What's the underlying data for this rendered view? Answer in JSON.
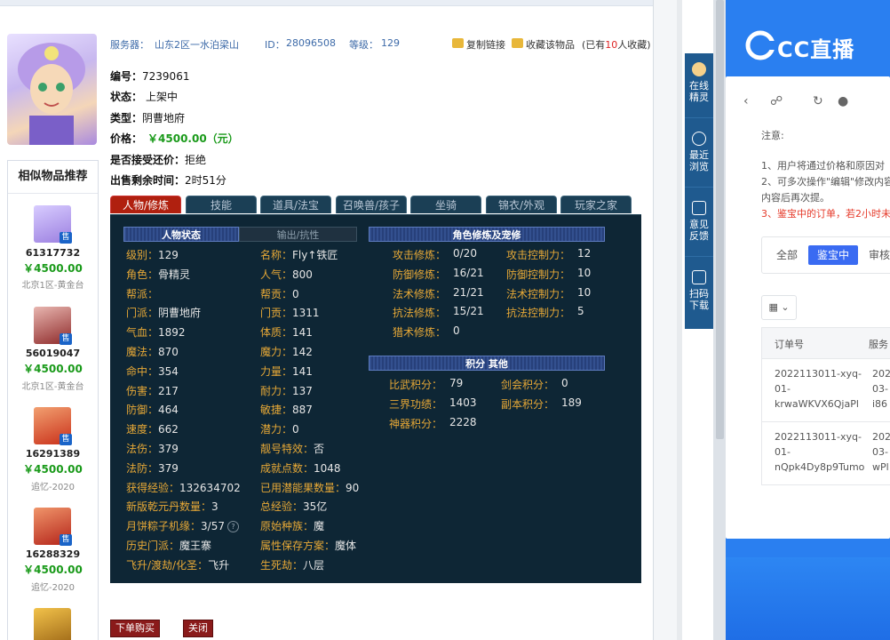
{
  "header": {
    "server_label": "服务器：",
    "server_value": "山东2区一水泊梁山",
    "id_label": "ID：",
    "id_value": "28096508",
    "level_label": "等级：",
    "level_value": "129",
    "copy_link": "复制链接",
    "favorite": "收藏该物品",
    "favorite_count_prefix": "(已有",
    "favorite_count": "10",
    "favorite_count_suffix": "人收藏)"
  },
  "info": {
    "number_label": "编号：",
    "number_value": "7239061",
    "status_label": "状态：",
    "status_value": "上架中",
    "type_label": "类型：",
    "type_value": "阴曹地府",
    "price_label": "价格：",
    "price_value": "￥4500.00（元）",
    "bargain_label": "是否接受还价：",
    "bargain_value": "拒绝",
    "remaining_label": "出售剩余时间：",
    "remaining_value": "2时51分"
  },
  "sidebar": {
    "title": "相似物品推荐",
    "badge": "售",
    "items": [
      {
        "id": "61317732",
        "price": "￥4500.00",
        "server": "北京1区-黄金台"
      },
      {
        "id": "56019047",
        "price": "￥4500.00",
        "server": "北京1区-黄金台"
      },
      {
        "id": "16291389",
        "price": "￥4500.00",
        "server": "追忆-2020"
      },
      {
        "id": "16288329",
        "price": "￥4500.00",
        "server": "追忆-2020"
      }
    ]
  },
  "tabs": [
    "人物/修炼",
    "技能",
    "道具/法宝",
    "召唤兽/孩子",
    "坐骑",
    "锦衣/外观",
    "玩家之家"
  ],
  "panel": {
    "subtab_active": "人物状态",
    "subtab_other": "输出/抗性",
    "cultivation_header": "角色修炼及宠修",
    "score_header": "积分 其他",
    "left_col": [
      {
        "label": "级别：",
        "value": "129"
      },
      {
        "label": "角色：",
        "value": "骨精灵"
      },
      {
        "label": "帮派：",
        "value": ""
      },
      {
        "label": "门派：",
        "value": "阴曹地府"
      },
      {
        "label": "气血：",
        "value": "1892"
      },
      {
        "label": "魔法：",
        "value": "870"
      },
      {
        "label": "命中：",
        "value": "354"
      },
      {
        "label": "伤害：",
        "value": "217"
      },
      {
        "label": "防御：",
        "value": "464"
      },
      {
        "label": "速度：",
        "value": "662"
      },
      {
        "label": "法伤：",
        "value": "379"
      },
      {
        "label": "法防：",
        "value": "379"
      },
      {
        "label": "获得经验：",
        "value": "132634702"
      },
      {
        "label": "新版乾元丹数量：",
        "value": "3"
      },
      {
        "label": "月饼粽子机缘：",
        "value": "3/57"
      },
      {
        "label": "历史门派：",
        "value": "魔王寨"
      },
      {
        "label": "飞升/渡劫/化圣：",
        "value": "飞升"
      }
    ],
    "right_col": [
      {
        "label": "名称：",
        "value": "Fly↑铁匠"
      },
      {
        "label": "人气：",
        "value": "800"
      },
      {
        "label": "帮贡：",
        "value": "0"
      },
      {
        "label": "门贡：",
        "value": "1311"
      },
      {
        "label": "体质：",
        "value": "141"
      },
      {
        "label": "魔力：",
        "value": "142"
      },
      {
        "label": "力量：",
        "value": "141"
      },
      {
        "label": "耐力：",
        "value": "137"
      },
      {
        "label": "敏捷：",
        "value": "887"
      },
      {
        "label": "潜力：",
        "value": "0"
      },
      {
        "label": "靓号特效：",
        "value": "否"
      },
      {
        "label": "成就点数：",
        "value": "1048"
      },
      {
        "label": "已用潜能果数量：",
        "value": "90"
      },
      {
        "label": "总经验：",
        "value": "35亿"
      },
      {
        "label": "原始种族：",
        "value": "魔"
      },
      {
        "label": "属性保存方案：",
        "value": "魔体"
      },
      {
        "label": "生死劫：",
        "value": "八层"
      }
    ],
    "cultivation_left": [
      {
        "label": "攻击修炼：",
        "value": "0/20"
      },
      {
        "label": "防御修炼：",
        "value": "16/21"
      },
      {
        "label": "法术修炼：",
        "value": "21/21"
      },
      {
        "label": "抗法修炼：",
        "value": "15/21"
      },
      {
        "label": "猎术修炼：",
        "value": "0"
      }
    ],
    "cultivation_right": [
      {
        "label": "攻击控制力：",
        "value": "12"
      },
      {
        "label": "防御控制力：",
        "value": "10"
      },
      {
        "label": "法术控制力：",
        "value": "10"
      },
      {
        "label": "抗法控制力：",
        "value": "5"
      }
    ],
    "score_left": [
      {
        "label": "比武积分：",
        "value": "79"
      },
      {
        "label": "三界功绩：",
        "value": "1403"
      },
      {
        "label": "神器积分：",
        "value": "2228"
      }
    ],
    "score_right": [
      {
        "label": "剑会积分：",
        "value": "0"
      },
      {
        "label": "副本积分：",
        "value": "189"
      }
    ]
  },
  "buttons": {
    "order": "下单购买",
    "close": "关闭"
  },
  "right_toolbar": [
    {
      "label": "在线\n精灵"
    },
    {
      "label": "最近\n浏览"
    },
    {
      "label": "意见\n反馈"
    },
    {
      "label": "扫码\n下载"
    }
  ],
  "cc": {
    "logo": "CC直播",
    "note_title": "注意:",
    "note_1": "1、用户将通过价格和原因对",
    "note_2": "2、可多次操作\"编辑\"修改内容",
    "note_2b": "内容后再次提。",
    "note_3": "3、鉴宝中的订单，若2小时未",
    "tab_all": "全部",
    "tab_active": "鉴宝中",
    "tab_review": "审核",
    "col_order": "订单号",
    "col_service": "服务",
    "rows": [
      {
        "order": "2022113011-xyq-\n01-\nkrwaWKVX6QjaPl",
        "service": "202\n03-\ni86"
      },
      {
        "order": "2022113011-xyq-\n01-\nnQpk4Dy8p9Tumo",
        "service": "202\n03-\nwPl"
      }
    ]
  }
}
